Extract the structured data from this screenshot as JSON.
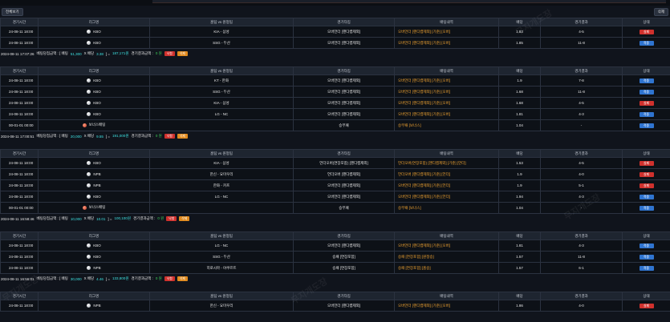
{
  "top": {
    "left_button": "전체보기",
    "right_button": "삭제"
  },
  "headers": [
    "경기시간",
    "리그명",
    "홈팀 vs 원정팀",
    "경기타입",
    "배팅내역",
    "배당",
    "경기결과",
    "상태"
  ],
  "watermark": "무지개도장",
  "sections": [
    {
      "rows": [
        {
          "time": "24-08-11 18:00",
          "league": "KBO",
          "ball": "white",
          "match": "KIA - 삼성",
          "type": "오버언더 [핸디캡제외]",
          "bet": "오버언더 [핸디캡제외] [기준] [오버]",
          "odds": "1.83",
          "score": "4-5",
          "status": "실패",
          "status_color": "red"
        },
        {
          "time": "24-08-11 18:00",
          "league": "KBO",
          "ball": "white",
          "match": "SSG - 두산",
          "type": "오버언더 [핸디캡제외]",
          "bet": "오버언더 [핸디캡제외] [기준] [오버]",
          "odds": "1.85",
          "score": "11-8",
          "status": "적중",
          "status_color": "blue"
        }
      ],
      "summary": {
        "datetime": "2024-08-11 17:07:26",
        "pre": "베팅당첨금액 : [ 배팅",
        "bet_amount": "51,300",
        "mid": "X 배당",
        "multiplier": "3.38",
        "post": "] =",
        "payout": "187,171원",
        "result_label": "경기결과금액 :",
        "result_value": "0 원",
        "tag_lost": "낙첨",
        "tag_del": "삭제"
      }
    },
    {
      "rows": [
        {
          "time": "24-08-11 18:00",
          "league": "KBO",
          "ball": "white",
          "match": "KT - 한화",
          "type": "오버언더 [핸디캡제외]",
          "bet": "오버언더 [핸디캡제외] [기준] [오버]",
          "odds": "1.9",
          "score": "7-8",
          "status": "적중",
          "status_color": "blue"
        },
        {
          "time": "24-08-11 18:00",
          "league": "KBO",
          "ball": "white",
          "match": "SSG - 두산",
          "type": "오버언더 [핸디캡제외]",
          "bet": "오버언더 [핸디캡제외] [기준] [오버]",
          "odds": "1.68",
          "score": "11-8",
          "status": "적중",
          "status_color": "blue"
        },
        {
          "time": "24-08-11 18:00",
          "league": "KBO",
          "ball": "white",
          "match": "KIA - 삼성",
          "type": "오버언더 [핸디캡제외]",
          "bet": "오버언더 [핸디캡제외] [기준] [오버]",
          "odds": "1.68",
          "score": "4-5",
          "status": "실패",
          "status_color": "red"
        },
        {
          "time": "24-08-11 18:00",
          "league": "KBO",
          "ball": "white",
          "match": "LG - NC",
          "type": "오버언더 [핸디캡제외]",
          "bet": "오버언더 [핸디캡제외] [기준] [오버]",
          "odds": "1.81",
          "score": "4-3",
          "status": "적중",
          "status_color": "blue"
        },
        {
          "time": "00-01-01 00:00",
          "league": "보너스배팅",
          "ball": "red",
          "match": "",
          "type": "승무패",
          "bet": "승무패 [보너스]",
          "odds": "1.04",
          "score": "-",
          "status": "적중",
          "status_color": "blue"
        }
      ],
      "summary": {
        "datetime": "2024-08-11 17:00:51",
        "pre": "베팅당첨금액 : [ 배팅",
        "bet_amount": "20,000",
        "mid": "X 배당",
        "multiplier": "9.55",
        "post": "] =",
        "payout": "191,000원",
        "result_label": "경기결과금액 :",
        "result_value": "0 원",
        "tag_lost": "낙첨",
        "tag_del": "삭제"
      }
    },
    {
      "rows": [
        {
          "time": "24-08-11 18:00",
          "league": "KBO",
          "ball": "white",
          "match": "KIA - 삼성",
          "type": "언더오버(연장포함) [핸디캡제외]",
          "bet": "언더오버(연장포함) [핸디캡제외] [기준] [언더]",
          "odds": "1.53",
          "score": "4-5",
          "status": "실패",
          "status_color": "red"
        },
        {
          "time": "24-08-11 18:00",
          "league": "NPB",
          "ball": "white",
          "match": "한신 - 요미우리",
          "type": "언더오버 [핸디캡제외]",
          "bet": "언더오버 [핸디캡제외] [기준] [언더]",
          "odds": "1.9",
          "score": "4-0",
          "status": "실패",
          "status_color": "red"
        },
        {
          "time": "24-08-11 18:00",
          "league": "NPB",
          "ball": "white",
          "match": "한화 - 카프",
          "type": "오버언더 [핸디캡제외]",
          "bet": "오버언더 [핸디캡제외] [기준] [언더]",
          "odds": "1.9",
          "score": "5-1",
          "status": "실패",
          "status_color": "red"
        },
        {
          "time": "24-08-11 18:00",
          "league": "KBO",
          "ball": "white",
          "match": "LG - NC",
          "type": "오버언더 [핸디캡제외]",
          "bet": "오버언더 [핸디캡제외] [기준] [언더]",
          "odds": "1.94",
          "score": "4-3",
          "status": "적중",
          "status_color": "blue"
        },
        {
          "time": "00-01-01 00:00",
          "league": "보너스배팅",
          "ball": "red",
          "match": "",
          "type": "승무패",
          "bet": "승무패 [보너스]",
          "odds": "1.04",
          "score": "-",
          "status": "적중",
          "status_color": "blue"
        }
      ],
      "summary": {
        "datetime": "2024-08-11 16:58:46",
        "pre": "베팅당첨금액 : [ 배팅",
        "bet_amount": "10,000",
        "mid": "X 배당",
        "multiplier": "10.01",
        "post": "] =",
        "payout": "100,100원",
        "result_label": "경기결과금액 :",
        "result_value": "0 원",
        "tag_lost": "낙첨",
        "tag_del": "삭제"
      }
    },
    {
      "rows": [
        {
          "time": "24-08-11 18:00",
          "league": "KBO",
          "ball": "white",
          "match": "LG - NC",
          "type": "오버언더 [핸디캡제외]",
          "bet": "오버언더 [핸디캡제외] [기준] [오버]",
          "odds": "1.81",
          "score": "4-3",
          "status": "적중",
          "status_color": "blue"
        },
        {
          "time": "24-08-11 18:00",
          "league": "KBO",
          "ball": "white",
          "match": "SSG - 두산",
          "type": "승패 [연장포함]",
          "bet": "승패 [연장포함] [원정승]",
          "odds": "1.57",
          "score": "11-8",
          "status": "적중",
          "status_color": "blue"
        },
        {
          "time": "24-08-11 18:00",
          "league": "NPB",
          "ball": "white",
          "match": "히로시마 - 야쿠르트",
          "type": "승패 [연장포함]",
          "bet": "승패 [연장포함] [홈승]",
          "odds": "1.57",
          "score": "6-1",
          "status": "적중",
          "status_color": "blue"
        }
      ],
      "summary": {
        "datetime": "2024-08-11 16:56:01",
        "pre": "베팅당첨금액 : [ 배팅",
        "bet_amount": "30,000",
        "mid": "X 배당",
        "multiplier": "4.46",
        "post": "] =",
        "payout": "133,800원",
        "result_label": "경기결과금액 :",
        "result_value": "0 원",
        "tag_lost": "낙첨",
        "tag_del": "삭제"
      }
    },
    {
      "rows": [
        {
          "time": "24-08-11 18:00",
          "league": "NPB",
          "ball": "white",
          "match": "한신 - 요미우리",
          "type": "오버언더 [핸디캡제외]",
          "bet": "오버언더 [핸디캡제외] [기준] [오버]",
          "odds": "1.86",
          "score": "4-0",
          "status": "실패",
          "status_color": "red"
        }
      ],
      "summary": null
    }
  ]
}
